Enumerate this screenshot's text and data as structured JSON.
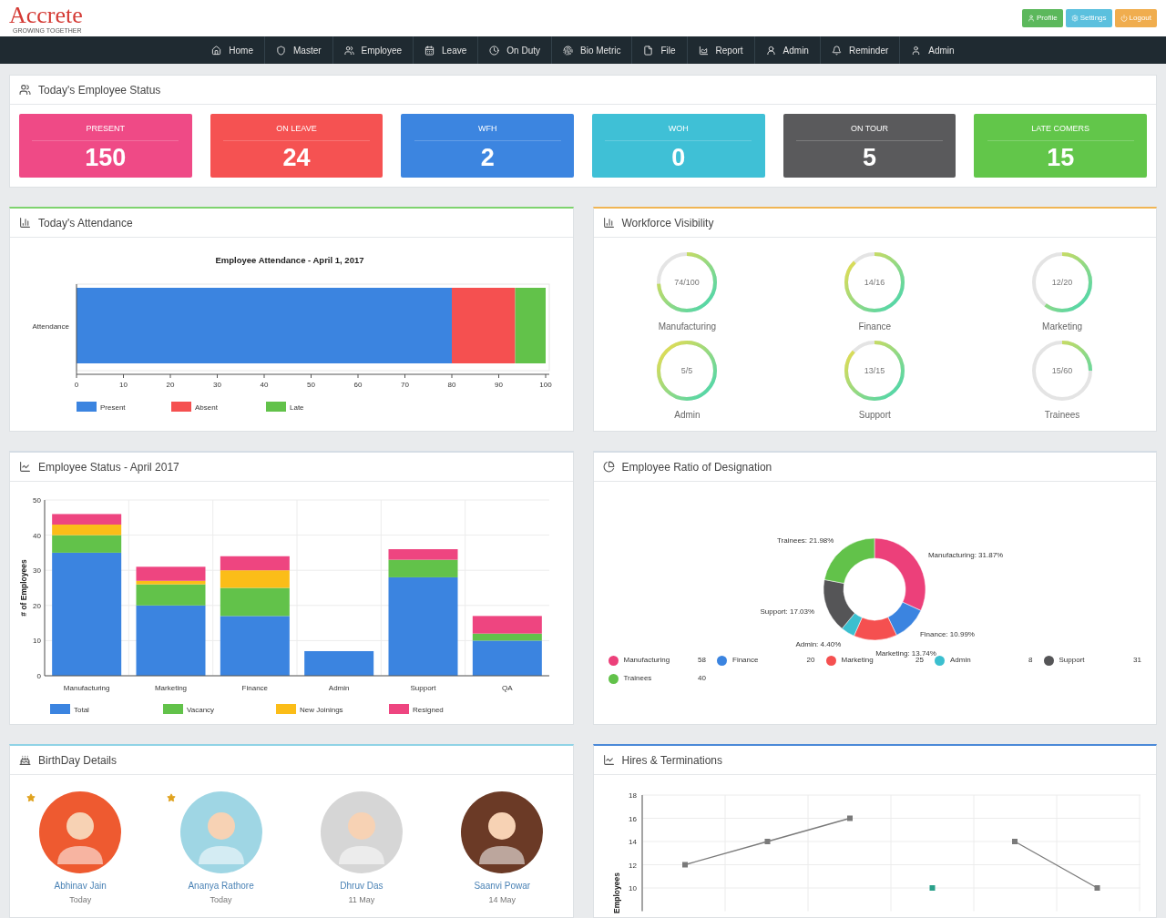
{
  "header": {
    "logo": {
      "name": "Accrete",
      "tagline": "GROWING TOGETHER"
    },
    "buttons": [
      {
        "label": "Profile",
        "kind": "profile"
      },
      {
        "label": "Settings",
        "kind": "settings"
      },
      {
        "label": "Logout",
        "kind": "logout"
      }
    ]
  },
  "nav": [
    "Home",
    "Master",
    "Employee",
    "Leave",
    "On Duty",
    "Bio Metric",
    "File",
    "Report",
    "Admin",
    "Reminder",
    "Admin"
  ],
  "employee_status": {
    "title": "Today's Employee Status",
    "cards": [
      {
        "label": "PRESENT",
        "value": "150",
        "color": "#ef4a86"
      },
      {
        "label": "ON LEAVE",
        "value": "24",
        "color": "#f55252"
      },
      {
        "label": "WFH",
        "value": "2",
        "color": "#3c85e0"
      },
      {
        "label": "WOH",
        "value": "0",
        "color": "#3fc0d6"
      },
      {
        "label": "ON TOUR",
        "value": "5",
        "color": "#5a5a5c"
      },
      {
        "label": "LATE COMERS",
        "value": "15",
        "color": "#62c64a"
      }
    ]
  },
  "attendance": {
    "title": "Today's Attendance",
    "chart_data": {
      "type": "bar",
      "orientation": "horizontal",
      "stacked": true,
      "legend": "bottom",
      "title": "Employee Attendance - April 1, 2017",
      "categories": [
        "Attendance"
      ],
      "xlim": [
        0,
        100
      ],
      "xticks": [
        0,
        10,
        20,
        30,
        40,
        50,
        60,
        70,
        80,
        90,
        100
      ],
      "series": [
        {
          "name": "Present",
          "color": "#3b84e0",
          "values": [
            80
          ]
        },
        {
          "name": "Absent",
          "color": "#f55050",
          "values": [
            13.5
          ]
        },
        {
          "name": "Late",
          "color": "#62c24a",
          "values": [
            6.5
          ]
        }
      ]
    }
  },
  "workforce": {
    "title": "Workforce Visibility",
    "gauges": [
      {
        "label": "Manufacturing",
        "reading": "74/100",
        "level": 0.74
      },
      {
        "label": "Finance",
        "reading": "14/16",
        "level": 0.875
      },
      {
        "label": "Marketing",
        "reading": "12/20",
        "level": 0.6
      },
      {
        "label": "Admin",
        "reading": "5/5",
        "level": 1
      },
      {
        "label": "Support",
        "reading": "13/15",
        "level": 0.867
      },
      {
        "label": "Trainees",
        "reading": "15/60",
        "level": 0.25
      }
    ]
  },
  "department_status": {
    "title": "Employee Status - April 2017",
    "chart_data": {
      "type": "bar",
      "stacked": true,
      "grid": true,
      "legend": "bottom",
      "ylabel": "# of Employees",
      "categories": [
        "Manufacturing",
        "Marketing",
        "Finance",
        "Admin",
        "Support",
        "QA"
      ],
      "ylim": [
        0,
        50
      ],
      "yticks": [
        0,
        10,
        20,
        30,
        40,
        50
      ],
      "series": [
        {
          "name": "Total",
          "color": "#3b84e0",
          "values": [
            35,
            20,
            17,
            7,
            28,
            10
          ]
        },
        {
          "name": "Vacancy",
          "color": "#62c24a",
          "values": [
            5,
            6,
            8,
            0,
            5,
            2
          ]
        },
        {
          "name": "New Joinings",
          "color": "#fbbd18",
          "values": [
            3,
            1,
            5,
            0,
            0,
            0
          ]
        },
        {
          "name": "Resigned",
          "color": "#ee4580",
          "values": [
            3,
            4,
            4,
            0,
            3,
            5
          ]
        }
      ]
    }
  },
  "designation_ratio": {
    "title": "Employee Ratio of Designation",
    "chart_data": {
      "type": "donut",
      "values": [
        31.87,
        10.99,
        13.74,
        4.4,
        17.03,
        21.98
      ],
      "value_labels": [
        "Manufacturing: 31.87%",
        "Finance: 10.99%",
        "Marketing: 13.74%",
        "Admin: 4.40%",
        "Support: 17.03%",
        "Trainees: 21.98%"
      ],
      "colors": [
        "#ec407a",
        "#3b84e0",
        "#f55050",
        "#3bbfcf",
        "#555557",
        "#62c24a"
      ]
    },
    "legend": [
      {
        "name": "Manufacturing",
        "count": "58",
        "color": "#ec407a"
      },
      {
        "name": "Finance",
        "count": "20",
        "color": "#3b84e0"
      },
      {
        "name": "Marketing",
        "count": "25",
        "color": "#f55050"
      },
      {
        "name": "Admin",
        "count": "8",
        "color": "#3bbfcf"
      },
      {
        "name": "Support",
        "count": "31",
        "color": "#555557"
      },
      {
        "name": "Trainees",
        "count": "40",
        "color": "#62c24a"
      }
    ]
  },
  "birthdays": {
    "title": "BirthDay Details",
    "people": [
      {
        "name": "Abhinav Jain",
        "date": "Today",
        "starred": true,
        "color": "#ee5a30"
      },
      {
        "name": "Ananya Rathore",
        "date": "Today",
        "starred": true,
        "color": "#9fd6e4"
      },
      {
        "name": "Dhruv Das",
        "date": "11 May",
        "starred": false,
        "color": "#d6d6d6"
      },
      {
        "name": "Saanvi Powar",
        "date": "14 May",
        "starred": false,
        "color": "#6b3a26"
      }
    ]
  },
  "hires": {
    "title": "Hires & Terminations",
    "chart_data": {
      "type": "line",
      "grid": true,
      "ylabel": "Employees",
      "ylim": [
        8,
        18
      ],
      "yticks": [
        10,
        12,
        14,
        16,
        18
      ],
      "series": [
        {
          "color": "#7a7a7a",
          "marker": "square",
          "values": [
            12,
            14,
            16,
            null,
            14,
            10
          ]
        },
        {
          "color": "#2aa08a",
          "marker": "square",
          "values": [
            null,
            null,
            null,
            10,
            null,
            null
          ]
        }
      ]
    }
  }
}
